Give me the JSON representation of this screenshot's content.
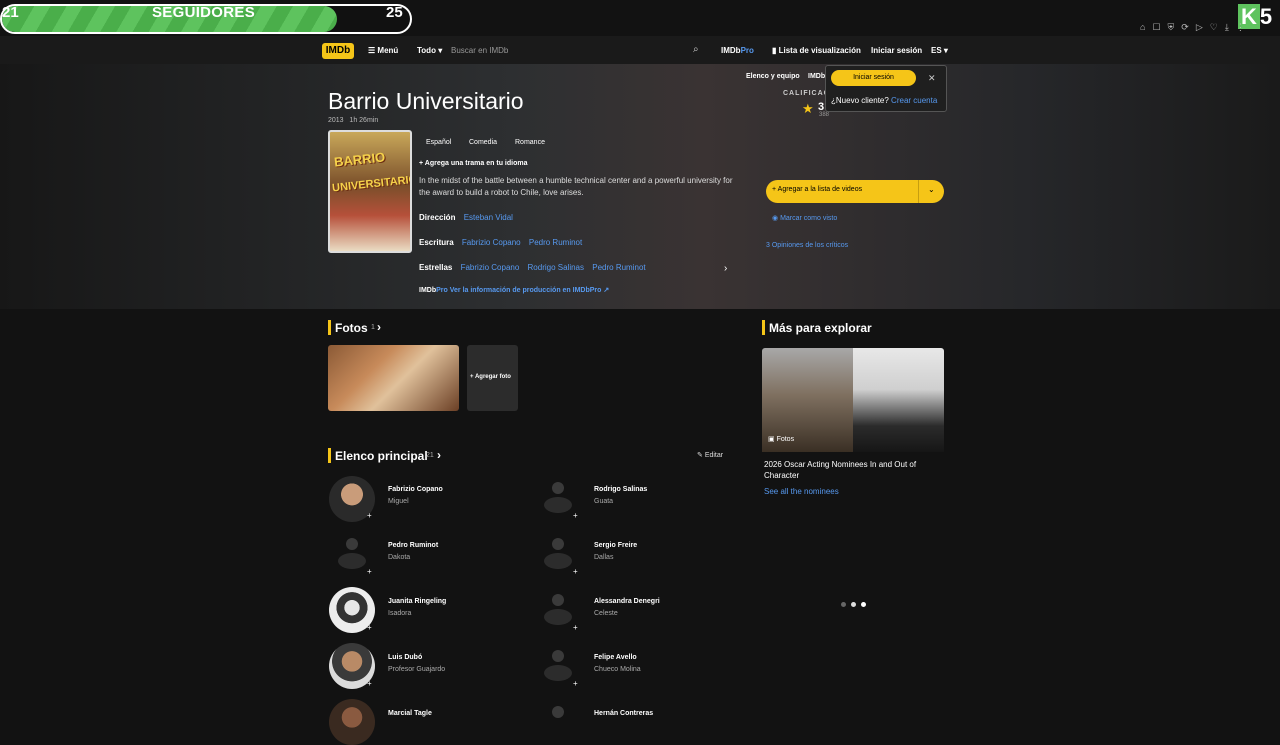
{
  "overlay": {
    "left_value": "21",
    "label": "SEGUIDORES",
    "right_value": "25",
    "progress_fraction": 0.82,
    "brand_letter": "K",
    "brand_number": "5",
    "accent": "#5ec35e"
  },
  "nav": {
    "logo": "IMDb",
    "menu": "Menú",
    "search_scope": "Todo",
    "search_placeholder": "Buscar en IMDb",
    "imdbpro_a": "IMDb",
    "imdbpro_b": "Pro",
    "watchlist": "Lista de visualización",
    "signin": "Iniciar sesión",
    "lang": "ES"
  },
  "subnav": {
    "cast_crew": "Elenco y equipo",
    "imdb_short": "IMDb"
  },
  "movie": {
    "title": "Barrio Universitario",
    "year": "2013",
    "runtime": "1h 26min",
    "poster_title_a": "BARRIO",
    "poster_title_b": "UNIVERSITARIO",
    "genres": [
      "Español",
      "Comedia",
      "Romance"
    ],
    "add_plot": "Agrega una trama en tu idioma",
    "plot": "In the midst of the battle between a humble technical center and a powerful university for the award to build a robot to Chile, love arises.",
    "direction_label": "Dirección",
    "directors": [
      "Esteban Vidal"
    ],
    "writing_label": "Escritura",
    "writers": [
      "Fabrizio Copano",
      "Pedro Ruminot"
    ],
    "stars_label": "Estrellas",
    "stars": [
      "Fabrizio Copano",
      "Rodrigo Salinas",
      "Pedro Ruminot"
    ],
    "imdbpro_brand_a": "IMDb",
    "imdbpro_brand_b": "Pro",
    "imdbpro_link": "Ver la información de producción en IMDbPro"
  },
  "rating": {
    "label": "CALIFICACIÓN",
    "value": "3",
    "count": "388"
  },
  "actions": {
    "watchlist_btn": "Agregar a la lista de videos",
    "mark_seen": "Marcar como visto",
    "critics_count": "3",
    "critics_label": "Opiniones de los críticos"
  },
  "popup": {
    "signin_btn": "Iniciar sesión",
    "new_customer": "¿Nuevo cliente?",
    "create_account": "Crear cuenta"
  },
  "photos": {
    "title": "Fotos",
    "count": "1",
    "add_photo": "+ Agregar foto"
  },
  "cast": {
    "title": "Elenco principal",
    "count": "21",
    "edit": "Editar",
    "items": [
      {
        "name": "Fabrizio Copano",
        "role": "Miguel"
      },
      {
        "name": "Rodrigo Salinas",
        "role": "Guata"
      },
      {
        "name": "Pedro Ruminot",
        "role": "Dakota"
      },
      {
        "name": "Sergio Freire",
        "role": "Dallas"
      },
      {
        "name": "Juanita Ringeling",
        "role": "Isadora"
      },
      {
        "name": "Alessandra Denegri",
        "role": "Celeste"
      },
      {
        "name": "Luis Dubó",
        "role": "Profesor Guajardo"
      },
      {
        "name": "Felipe Avello",
        "role": "Chueco Molina"
      },
      {
        "name": "Marcial Tagle",
        "role": ""
      },
      {
        "name": "Hernán Contreras",
        "role": ""
      }
    ]
  },
  "explore": {
    "title": "Más para explorar",
    "photos_label": "Fotos",
    "caption": "2026 Oscar Acting Nominees In and Out of Character",
    "link": "See all the nominees"
  }
}
